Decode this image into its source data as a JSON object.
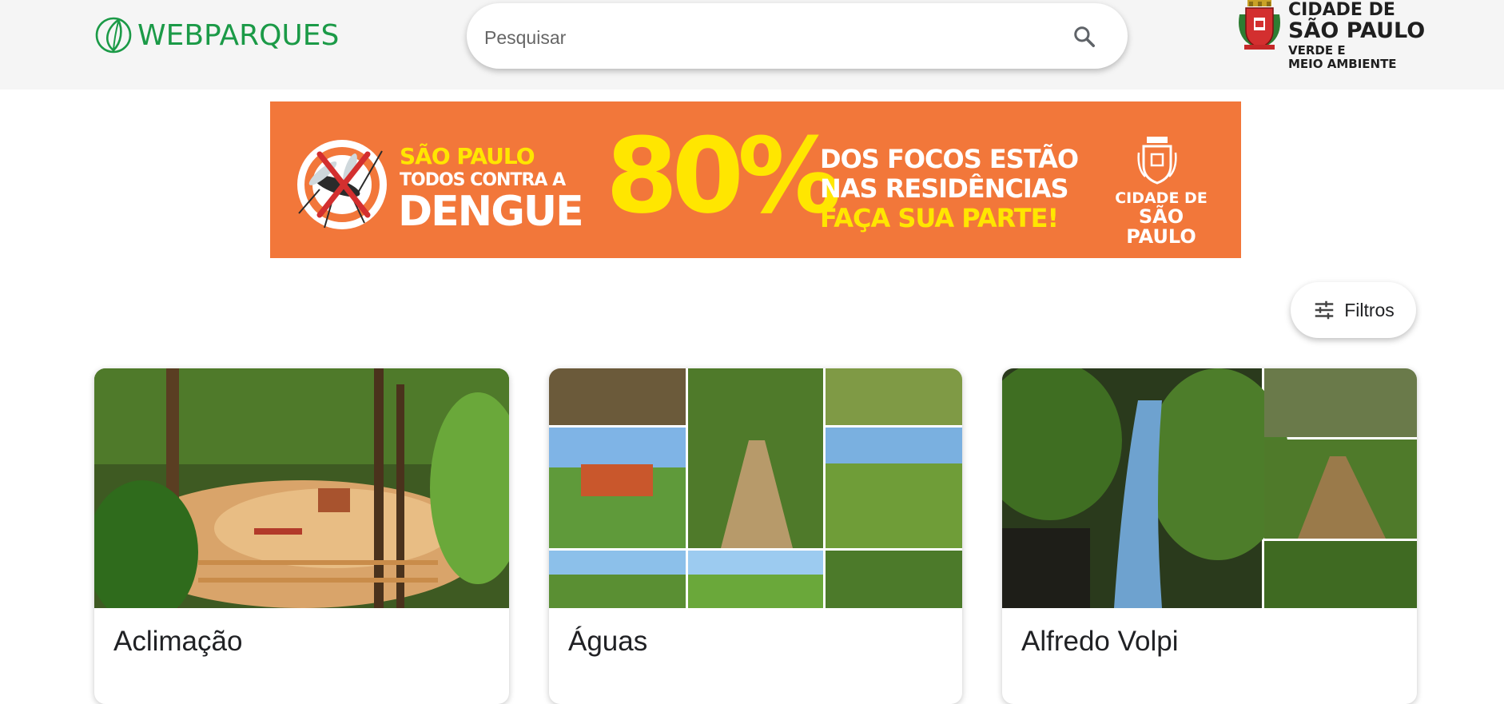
{
  "header": {
    "logo_text": "WEBPARQUES",
    "search": {
      "placeholder": "Pesquisar",
      "value": ""
    },
    "city": {
      "line1": "CIDADE DE",
      "line2": "SÃO PAULO",
      "line3": "VERDE E",
      "line4": "MEIO AMBIENTE"
    }
  },
  "banner": {
    "line_sp": "SÃO PAULO",
    "line_todos": "TODOS CONTRA A",
    "line_dengue": "DENGUE",
    "percent": "80%",
    "line1": "DOS FOCOS ESTÃO",
    "line2": "NAS RESIDÊNCIAS",
    "line3": "FAÇA SUA PARTE!",
    "city1": "CIDADE DE",
    "city2": "SÃO PAULO"
  },
  "filters": {
    "label": "Filtros"
  },
  "parks": [
    {
      "name": "Aclimação"
    },
    {
      "name": "Águas"
    },
    {
      "name": "Alfredo Volpi"
    }
  ],
  "colors": {
    "brand_green": "#1b9a47",
    "banner_orange": "#f2773a",
    "banner_yellow": "#ffe600",
    "header_bg": "#f5f5f5"
  },
  "icons": {
    "search": "search-icon",
    "filters": "tune-icon"
  }
}
